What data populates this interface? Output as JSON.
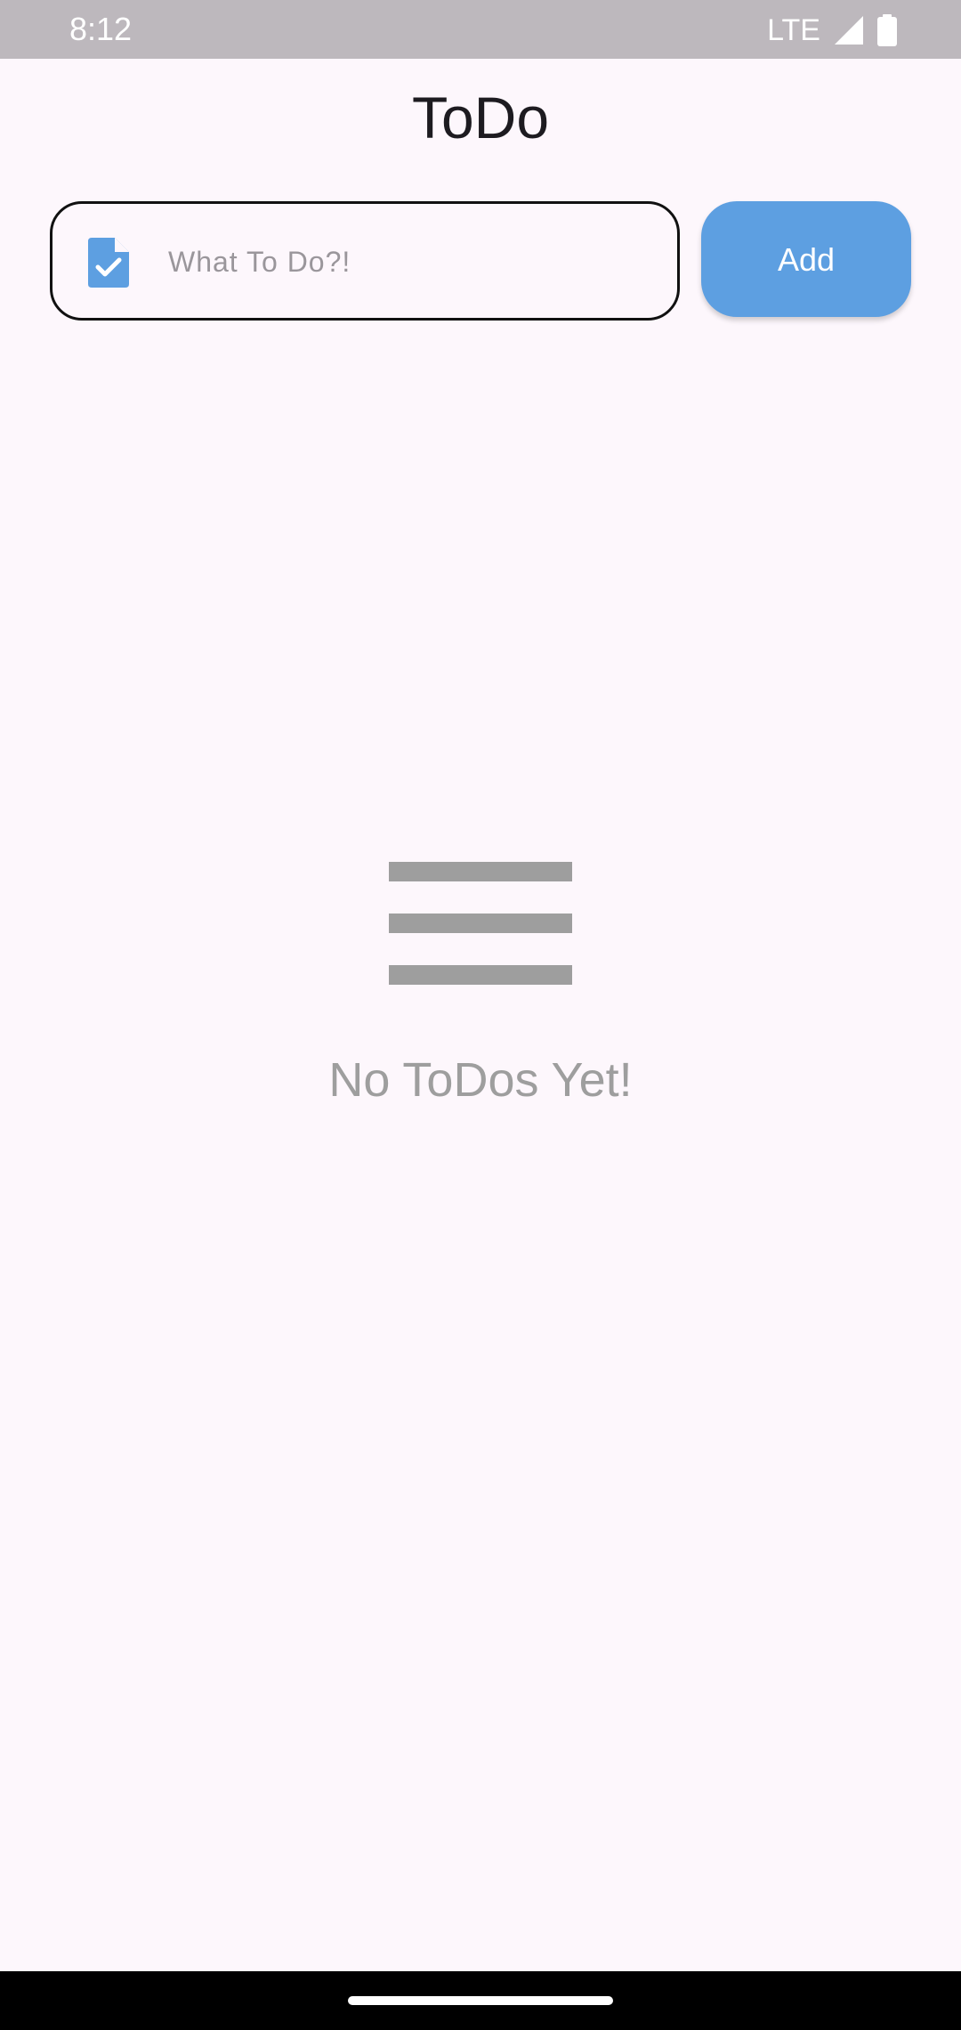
{
  "status_bar": {
    "time": "8:12",
    "network": "LTE",
    "icons": [
      "signal-icon",
      "battery-icon"
    ]
  },
  "app": {
    "title": "ToDo"
  },
  "input": {
    "placeholder": "What To Do?!",
    "value": "",
    "icon": "task-document-icon"
  },
  "add_button": {
    "label": "Add"
  },
  "empty_state": {
    "icon": "list-lines-icon",
    "message": "No ToDos Yet!"
  },
  "colors": {
    "accent": "#5d9fe1",
    "background": "#fdf7fc",
    "status_bar": "#bdb8bd",
    "muted": "#9e9e9e"
  }
}
